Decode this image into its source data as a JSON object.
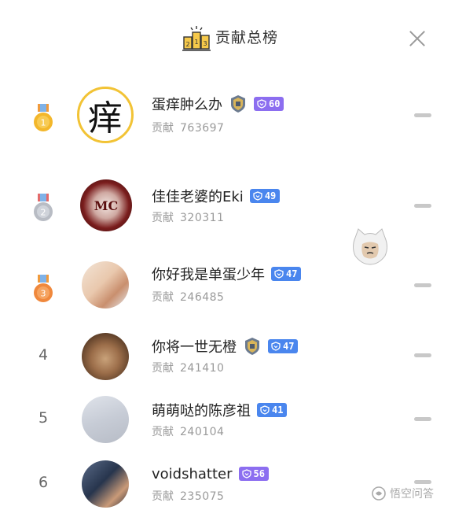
{
  "header": {
    "title": "贡献总榜"
  },
  "rows": [
    {
      "rank": "1",
      "name": "蛋痒肿么办",
      "contrib_label": "贡献",
      "contrib_value": "763697",
      "level": "60",
      "avatar_text": "痒"
    },
    {
      "rank": "2",
      "name": "佳佳老婆的Eki",
      "contrib_label": "贡献",
      "contrib_value": "320311",
      "level": "49",
      "avatar_text": "MC"
    },
    {
      "rank": "3",
      "name": "你好我是单蛋少年",
      "contrib_label": "贡献",
      "contrib_value": "246485",
      "level": "47"
    },
    {
      "rank": "4",
      "name": "你将一世无橙",
      "contrib_label": "贡献",
      "contrib_value": "241410",
      "level": "47"
    },
    {
      "rank": "5",
      "name": "萌萌哒的陈彦祖",
      "contrib_label": "贡献",
      "contrib_value": "240104",
      "level": "41"
    },
    {
      "rank": "6",
      "name": "voidshatter",
      "contrib_label": "贡献",
      "contrib_value": "235075",
      "level": "56"
    }
  ],
  "watermark": {
    "text": "悟空问答"
  },
  "colors": {
    "level_blue": "#4a86ee",
    "level_purple": "#8c6ef0",
    "gold": "#f3b72b",
    "silver": "#b8bcc4",
    "bronze": "#f0883c"
  }
}
